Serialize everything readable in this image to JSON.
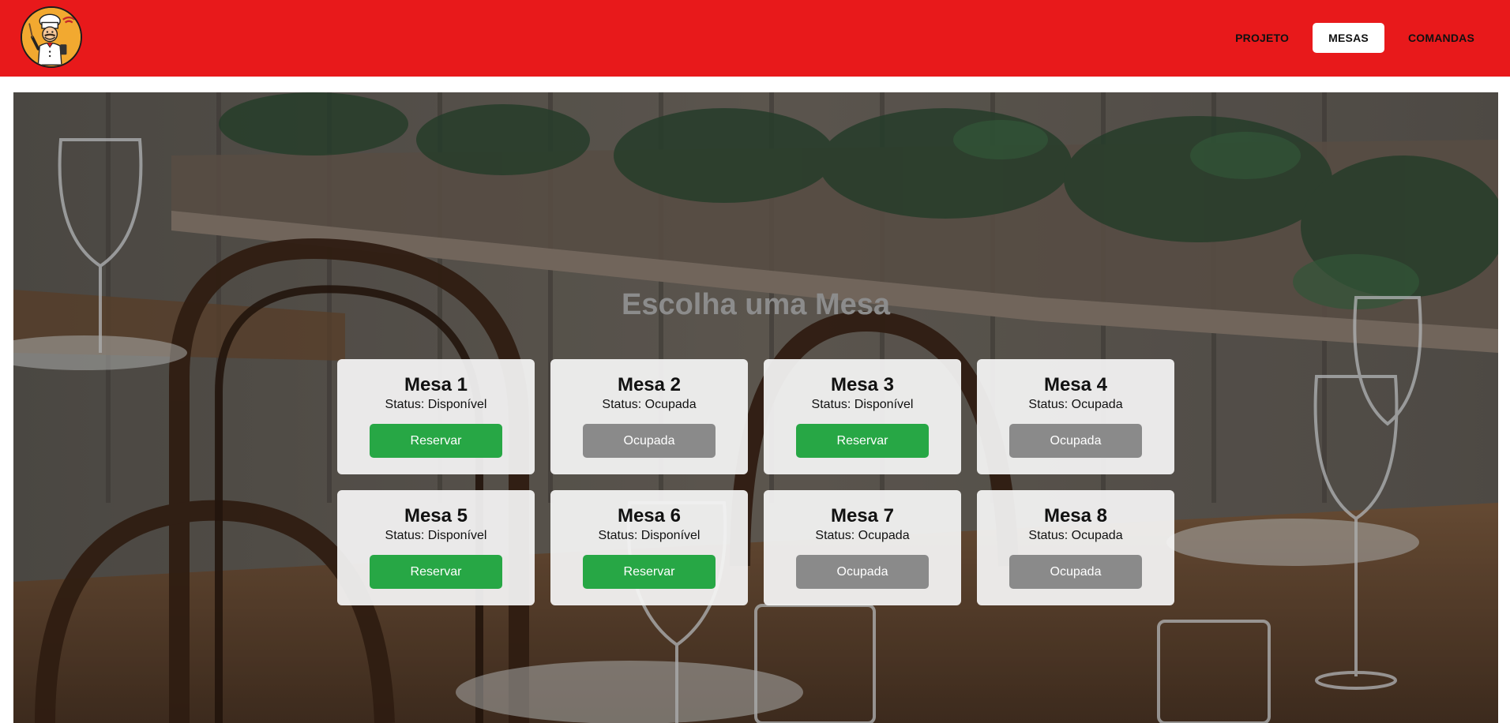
{
  "colors": {
    "header_bg": "#e8191b",
    "available": "#27a745",
    "occupied": "#8a8a8a"
  },
  "header": {
    "logo_icon": "chef-mascot-icon",
    "nav": [
      {
        "label": "PROJETO",
        "active": false
      },
      {
        "label": "MESAS",
        "active": true
      },
      {
        "label": "COMANDAS",
        "active": false
      }
    ]
  },
  "main": {
    "heading": "Escolha uma Mesa",
    "tables": [
      {
        "title": "Mesa 1",
        "status": "Status: Disponível",
        "button": "Reservar",
        "state": "available"
      },
      {
        "title": "Mesa 2",
        "status": "Status: Ocupada",
        "button": "Ocupada",
        "state": "occupied"
      },
      {
        "title": "Mesa 3",
        "status": "Status: Disponível",
        "button": "Reservar",
        "state": "available"
      },
      {
        "title": "Mesa 4",
        "status": "Status: Ocupada",
        "button": "Ocupada",
        "state": "occupied"
      },
      {
        "title": "Mesa 5",
        "status": "Status: Disponível",
        "button": "Reservar",
        "state": "available"
      },
      {
        "title": "Mesa 6",
        "status": "Status: Disponível",
        "button": "Reservar",
        "state": "available"
      },
      {
        "title": "Mesa 7",
        "status": "Status: Ocupada",
        "button": "Ocupada",
        "state": "occupied"
      },
      {
        "title": "Mesa 8",
        "status": "Status: Ocupada",
        "button": "Ocupada",
        "state": "occupied"
      }
    ]
  }
}
